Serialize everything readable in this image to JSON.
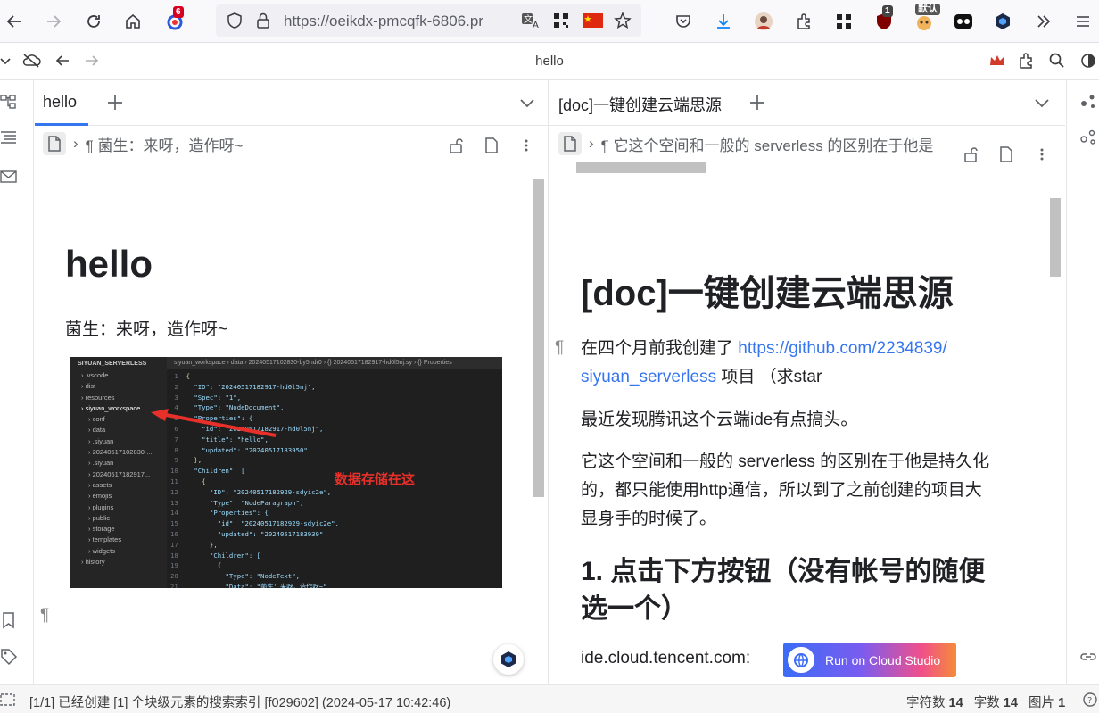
{
  "browser": {
    "url": "https://oeikdx-pmcqfk-6806.pr",
    "notification_badge": "6",
    "ext_badge_1": "1",
    "ext_badge_2": "默认"
  },
  "app": {
    "title": "hello"
  },
  "left_panel": {
    "tab_label": "hello",
    "breadcrumb": "¶ 菌生：来呀，造作呀~",
    "doc_title": "hello",
    "paragraph": "菌生：来呀，造作呀~",
    "empty_block_mark": "¶",
    "screenshot": {
      "explorer_title": "SIYUAN_SERVERLESS",
      "tab_path": "siyuan_workspace › data › 20240517102830-by5ndr0 › {} 20240517182917-hd0l5nj.sy › {} Properties",
      "tree": [
        ".vscode",
        "dist",
        "resources",
        "siyuan_workspace",
        "conf",
        "data",
        ".siyuan",
        "20240517102830-...",
        ".siyuan",
        "20240517182917...",
        "assets",
        "emojis",
        "plugins",
        "public",
        "storage",
        "templates",
        "widgets",
        "history"
      ],
      "code_lines": [
        "{",
        "  \"ID\": \"20240517182917-hd0l5nj\",",
        "  \"Spec\": \"1\",",
        "  \"Type\": \"NodeDocument\",",
        "  \"Properties\": {",
        "    \"id\": \"20240517182917-hd0l5nj\",",
        "    \"title\": \"hello\",",
        "    \"updated\": \"20240517183950\"",
        "  },",
        "  \"Children\": [",
        "    {",
        "      \"ID\": \"20240517182929-sdyic2e\",",
        "      \"Type\": \"NodeParagraph\",",
        "      \"Properties\": {",
        "        \"id\": \"20240517182929-sdyic2e\",",
        "        \"updated\": \"20240517183939\"",
        "      },",
        "      \"Children\": [",
        "        {",
        "          \"Type\": \"NodeText\",",
        "          \"Data\": \"菌生：来呀，造作呀~\""
      ],
      "annotation": "数据存储在这"
    }
  },
  "right_panel": {
    "tab_label": "[doc]一键创建云端思源",
    "breadcrumb": "¶ 它这个空间和一般的 serverless 的区别在于他是",
    "doc_title": "[doc]一键创建云端思源",
    "para1_prefix": "在四个月前我创建了 ",
    "para1_link_line1": "https://github.com/2234839/",
    "para1_link_line2": "siyuan_serverless",
    "para1_suffix": " 项目 （求star",
    "para2": "最近发现腾讯这个云端ide有点搞头。",
    "para3_line1": "它这个空间和一般的 serverless 的区别在于他是持久化",
    "para3_line2": "的，都只能使用http通信，所以到了之前创建的项目大",
    "para3_line3": "显身手的时候了。",
    "h2_line1": "1. 点击下方按钮（没有帐号的随便",
    "h2_line2": "选一个）",
    "ide_label": "ide.cloud.tencent.com:",
    "cloud_button": "Run on Cloud Studio"
  },
  "status": {
    "message": "[1/1] 已经创建 [1] 个块级元素的搜索索引 [f029602] (2024-05-17 10:42:46)",
    "char_count_label": "字符数",
    "char_count": "14",
    "word_count_label": "字数",
    "word_count": "14",
    "image_count_label": "图片",
    "image_count": "1"
  },
  "colors": {
    "accent": "#3575f0",
    "link": "#3575f0",
    "annotation_red": "#e8302a"
  }
}
